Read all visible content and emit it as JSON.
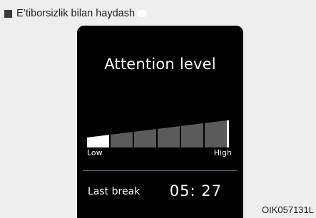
{
  "caption": {
    "text": "E’tiborsizlik bilan haydash"
  },
  "cluster": {
    "title": "Attention level",
    "gauge": {
      "low_label": "Low",
      "high_label": "High",
      "segments": 6,
      "filled_segments": 1,
      "level_fraction": 0.1
    },
    "last_break": {
      "label": "Last break",
      "time": "05: 27"
    }
  },
  "figure_code": "OIK057131L",
  "colors": {
    "page_background": "#eeeeee",
    "screen_background": "#000000",
    "filled_segment": "#ffffff",
    "empty_segment": "#5b5b5b"
  }
}
